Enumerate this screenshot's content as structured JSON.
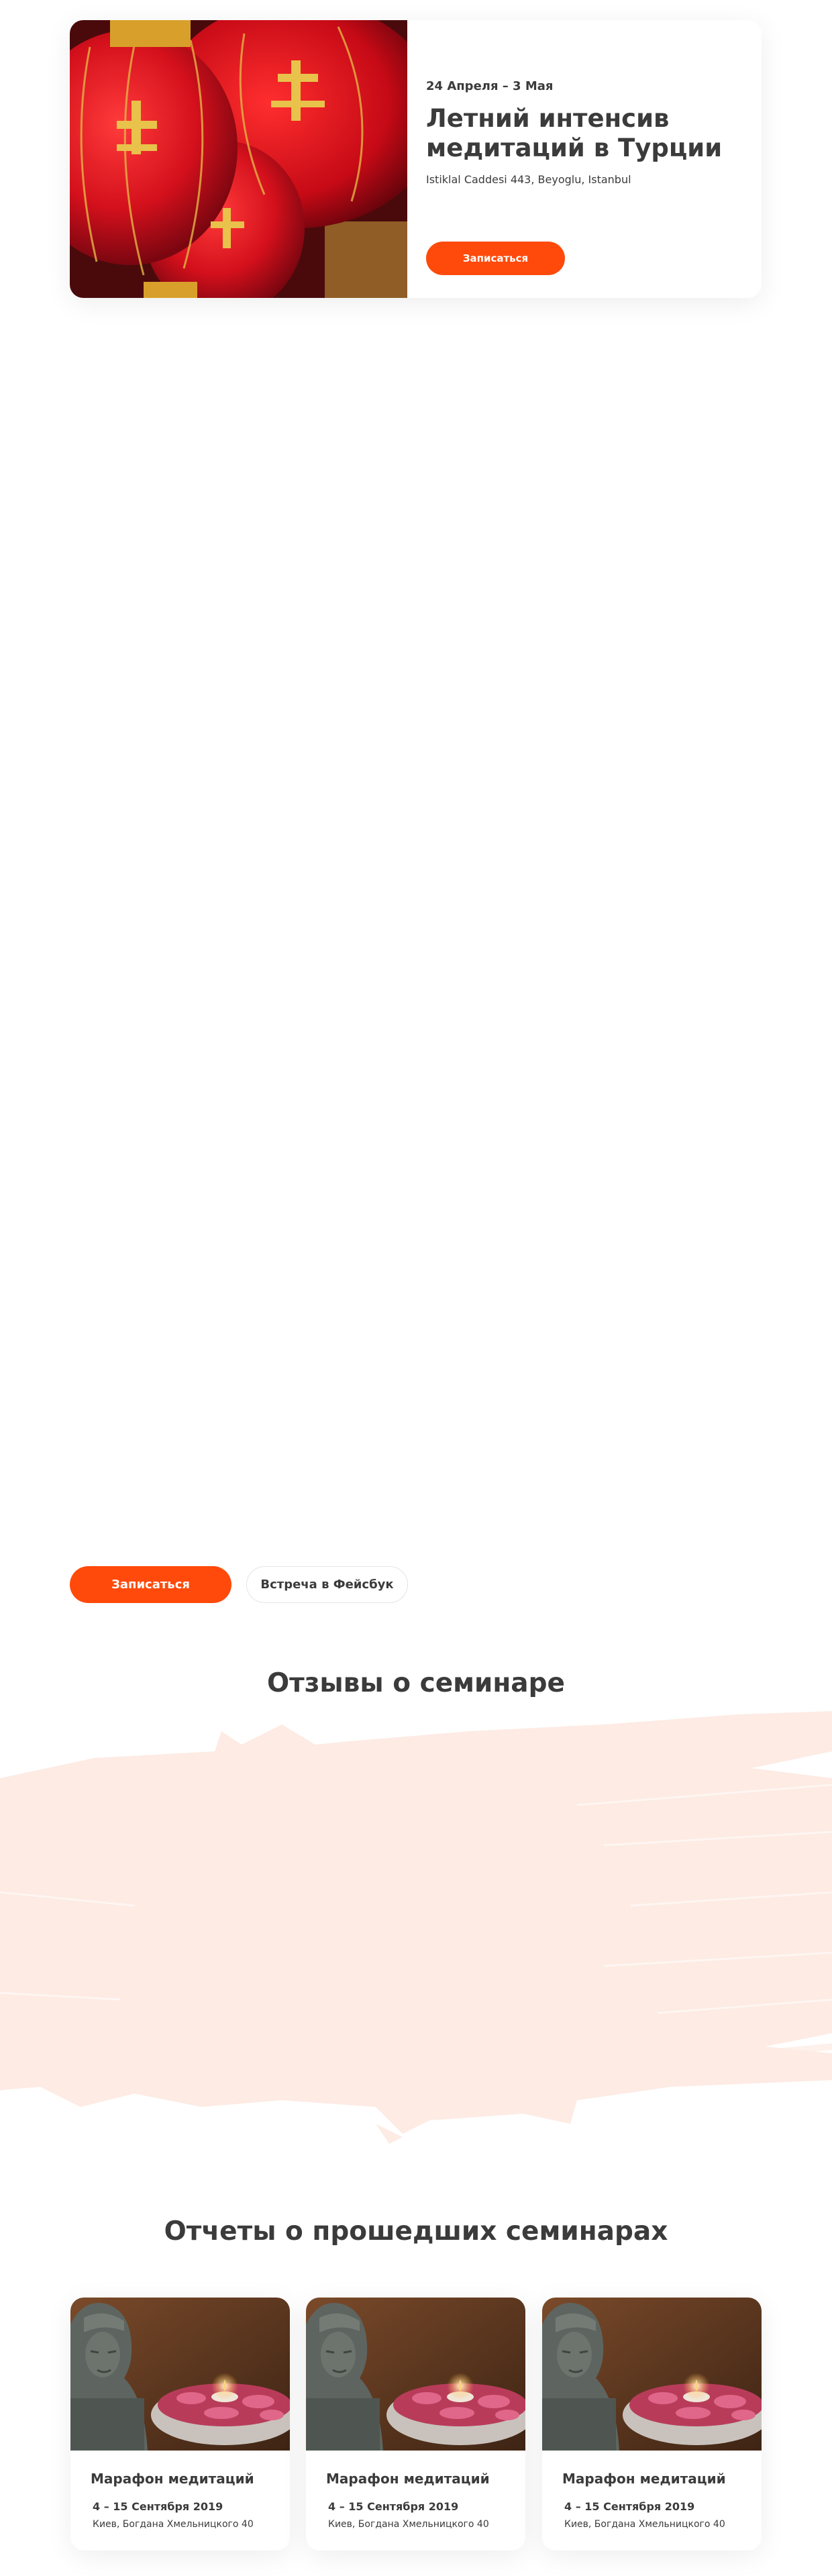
{
  "hero": {
    "date": "24 Апреля – 3 Мая",
    "title": "Летний интенсив медитаций в Турции",
    "address": "Istiklal Caddesi 443, Beyoglu, Istanbul",
    "signup_label": "Записаться",
    "image_icon": "chinese-lanterns-photo"
  },
  "cta": {
    "signup_label": "Записаться",
    "facebook_label": "Встреча в Фейсбук"
  },
  "reviews": {
    "title": "Отзывы о семинаре"
  },
  "reports": {
    "title": "Отчеты о прошедших семинарах",
    "items": [
      {
        "title": "Марафон медитаций",
        "date": "4 – 15 Сентября 2019",
        "address": "Киев, Богдана Хмельницкого 40",
        "image_icon": "buddha-candle-photo"
      },
      {
        "title": "Марафон медитаций",
        "date": "4 – 15 Сентября 2019",
        "address": "Киев, Богдана Хмельницкого 40",
        "image_icon": "buddha-candle-photo"
      },
      {
        "title": "Марафон медитаций",
        "date": "4 – 15 Сентября 2019",
        "address": "Киев, Богдана Хмельницкого 40",
        "image_icon": "buddha-candle-photo"
      }
    ]
  },
  "colors": {
    "accent": "#ff4a0b",
    "text": "#3b3b3b",
    "brush": "#fdebe4"
  }
}
